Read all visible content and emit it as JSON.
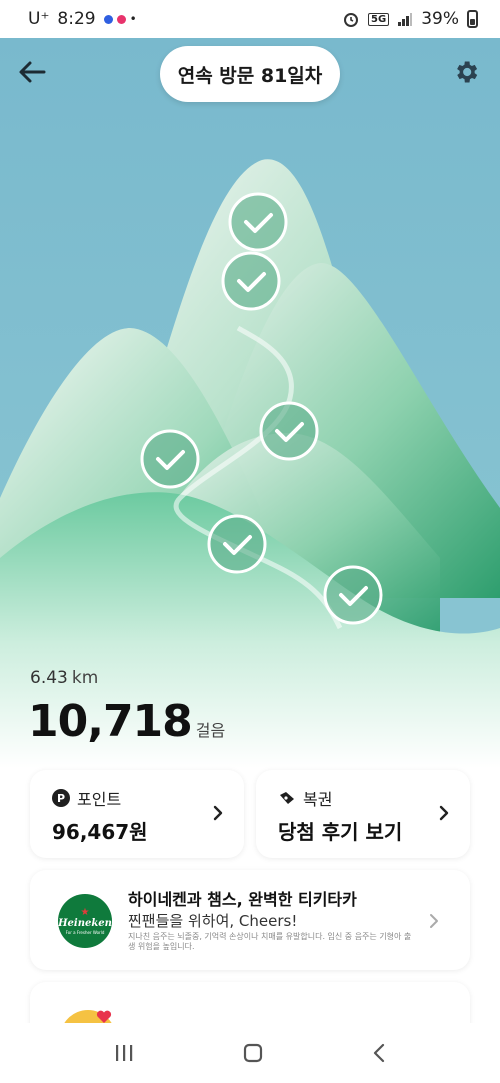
{
  "status_bar": {
    "carrier": "U⁺",
    "time": "8:29",
    "network": "5G",
    "battery": "39%"
  },
  "header": {
    "back_icon": "back-arrow-icon",
    "streak_label": "연속 방문 81일차",
    "settings_icon": "gear-icon"
  },
  "scene": {
    "checkpoints_completed": 6,
    "sky_color": "#7dbdd0",
    "mountain_color": "#4fbf8e"
  },
  "activity": {
    "distance_value": "6.43",
    "distance_unit": "km",
    "steps_value": "10,718",
    "steps_unit": "걸음"
  },
  "points_card": {
    "icon": "P",
    "label": "포인트",
    "value": "96,467원"
  },
  "lottery_card": {
    "icon": "ticket-icon",
    "label": "복권",
    "value": "당첨 후기 보기"
  },
  "ad_card": {
    "logo_brand": "Heineken",
    "logo_tagline": "For a Fresher World",
    "title": "하이네켄과 챔스, 완벽한 티키타카",
    "subtitle": "찐팬들을 위하여, Cheers!",
    "warning": "지나친 음주는 뇌졸중, 기억력 손상이나 치매를 유발합니다. 임신 중 음주는 기형아 출생 위험을 높입니다."
  },
  "nav_bar": {
    "recent_icon": "recents-icon",
    "home_icon": "home-icon",
    "back_icon": "back-chevron-icon"
  }
}
